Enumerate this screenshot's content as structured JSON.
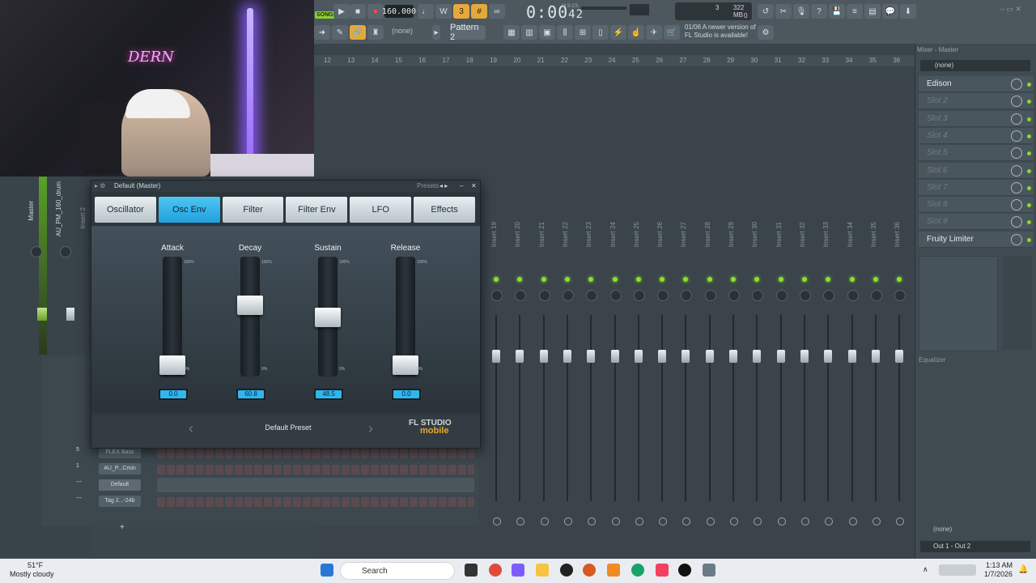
{
  "toolbar": {
    "song_badge": "SONG",
    "tempo": "160.000",
    "time": "0:00",
    "time_sub": "42",
    "time_unit": "M:S:CS",
    "cpu_voices": "3",
    "cpu_ram": "322 MB",
    "cpu_poly": "0",
    "snap": "(none)",
    "pattern": "Pattern 2",
    "notice_line1": "01/06  A newer version of",
    "notice_line2": "FL Studio is available!"
  },
  "ruler": [
    "12",
    "13",
    "14",
    "15",
    "16",
    "17",
    "18",
    "19",
    "20",
    "21",
    "22",
    "23",
    "24",
    "25",
    "26",
    "27",
    "28",
    "29",
    "30",
    "31",
    "32",
    "33",
    "34",
    "35",
    "36"
  ],
  "mixer": {
    "left_labels": [
      "Master",
      "AU_PM_160_drum",
      "Insert 2"
    ],
    "insert_labels": [
      "Insert 19",
      "Insert 20",
      "Insert 21",
      "Insert 22",
      "Insert 23",
      "Insert 24",
      "Insert 25",
      "Insert 26",
      "Insert 27",
      "Insert 28",
      "Insert 29",
      "Insert 30",
      "Insert 31",
      "Insert 32",
      "Insert 33",
      "Insert 34",
      "Insert 35",
      "Insert 36"
    ]
  },
  "mixer_panel": {
    "title": "Mixer - Master",
    "input": "(none)",
    "slots": [
      {
        "label": "Edison",
        "active": true
      },
      {
        "label": "Slot 2",
        "active": false
      },
      {
        "label": "Slot 3",
        "active": false
      },
      {
        "label": "Slot 4",
        "active": false
      },
      {
        "label": "Slot 5",
        "active": false
      },
      {
        "label": "Slot 6",
        "active": false
      },
      {
        "label": "Slot 7",
        "active": false
      },
      {
        "label": "Slot 8",
        "active": false
      },
      {
        "label": "Slot 9",
        "active": false
      },
      {
        "label": "Fruity Limiter",
        "active": true
      }
    ],
    "eq_label": "Equalizer",
    "output_none": "(none)",
    "output": "Out 1 - Out 2"
  },
  "plugin": {
    "title": "Default (Master)",
    "presets_label": "Presets",
    "tabs": [
      "Oscillator",
      "Osc Env",
      "Filter",
      "Filter Env",
      "LFO",
      "Effects"
    ],
    "selected_tab": "Osc Env",
    "envelope": [
      {
        "name": "Attack",
        "value": "0.0",
        "level": 0.0
      },
      {
        "name": "Decay",
        "value": "60.8",
        "level": 0.608
      },
      {
        "name": "Sustain",
        "value": "48.5",
        "level": 0.485
      },
      {
        "name": "Release",
        "value": "0.0",
        "level": 0.0
      }
    ],
    "scale_top": "100%",
    "scale_bottom": "0%",
    "preset_name": "Default Preset",
    "logo_top": "FL STUDIO",
    "logo_bottom": "mobile"
  },
  "channel_rack": [
    {
      "num": "5",
      "name": "FLEX Bass"
    },
    {
      "num": "1",
      "name": "AU_P...Cmin"
    },
    {
      "num": "---",
      "name": "Default"
    },
    {
      "num": "---",
      "name": "Tag 2...-24b"
    }
  ],
  "taskbar": {
    "temp": "51°F",
    "weather": "Mostly cloudy",
    "search": "Search",
    "time": "1:13 AM",
    "date": "1/7/2026"
  },
  "webcam_sign": "DERN"
}
